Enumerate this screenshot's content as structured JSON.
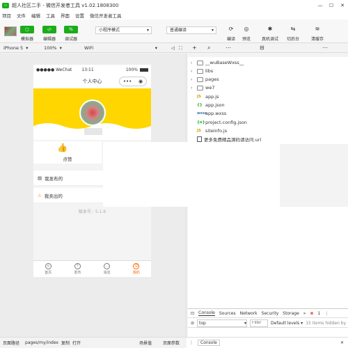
{
  "window": {
    "title": "超人社区二手 - 微信开发者工具 v1.02.1808300",
    "min": "—",
    "max": "☐",
    "close": "✕"
  },
  "menu": [
    "项目",
    "文件",
    "编辑",
    "工具",
    "界面",
    "设置",
    "微信开发者工具"
  ],
  "toolbar": {
    "simulator_label": "模拟器",
    "editor_label": "编辑器",
    "debugger_label": "调试器",
    "simulator_icon": "▢",
    "editor_icon": "‹/›",
    "debugger_icon": "%",
    "mode_select": "小程序模式",
    "compile_select": "普通编译",
    "compile_label": "编译",
    "preview_label": "预览",
    "remote_debug_label": "真机调试",
    "backend_label": "切后台",
    "clear_cache_label": "清缓存"
  },
  "simulator_settings": {
    "device": "iPhone 5",
    "zoom": "100%",
    "network": "WiFi"
  },
  "phone": {
    "status": {
      "carrier": "●●●●● WeChat",
      "time": "13:11",
      "battery": "100%"
    },
    "nav_title": "个人中心",
    "capsule_more": "•••",
    "capsule_close": "◉",
    "like_label": "点赞",
    "menu_items": [
      {
        "label": "我发布的",
        "icon": "publish-icon"
      },
      {
        "label": "我卖出的",
        "icon": "sold-icon"
      }
    ],
    "version": "版本号：5.1.6",
    "tabs": [
      {
        "label": "首页"
      },
      {
        "label": "发布"
      },
      {
        "label": "消息"
      },
      {
        "label": "我的",
        "active": true
      }
    ]
  },
  "file_tree": [
    {
      "type": "folder",
      "name": "__wuBaseWxss__"
    },
    {
      "type": "folder",
      "name": "libs"
    },
    {
      "type": "folder",
      "name": "pages"
    },
    {
      "type": "folder",
      "name": "we7"
    },
    {
      "type": "js",
      "name": "app.js"
    },
    {
      "type": "json",
      "name": "app.json"
    },
    {
      "type": "wxss",
      "name": "app.wxss"
    },
    {
      "type": "config",
      "name": "project.config.json"
    },
    {
      "type": "js",
      "name": "siteinfo.js"
    },
    {
      "type": "file",
      "name": "更多免费精品源码请访问.url"
    }
  ],
  "console": {
    "tabs": [
      "Console",
      "Sources",
      "Network",
      "Security",
      "Storage"
    ],
    "more": "»",
    "error_count": "1",
    "context": "top",
    "filter_placeholder": "Filter",
    "levels": "Default levels ▾",
    "hidden": "15 items hidden by"
  },
  "bottom": {
    "path_label": "页面路径",
    "path": "pages/my/index",
    "copy": "复制",
    "open": "打开",
    "scene": "场景值",
    "params": "页面参数",
    "drawer_tab": "Console"
  }
}
